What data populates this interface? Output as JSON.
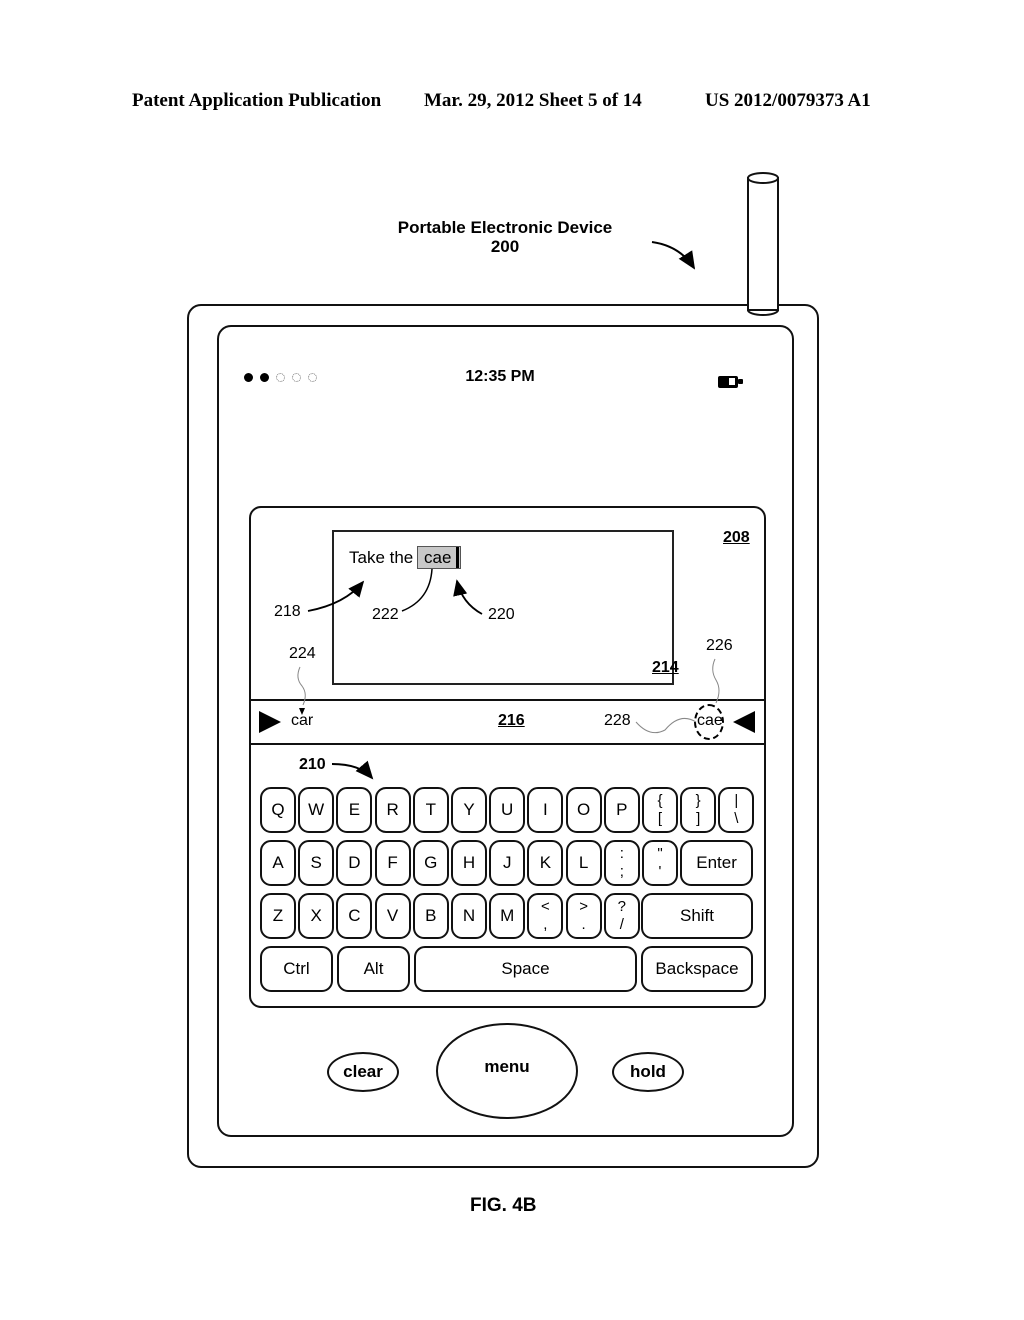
{
  "header": {
    "publication": "Patent Application Publication",
    "date_sheet": "Mar. 29, 2012  Sheet 5 of 14",
    "patent_number": "US 2012/0079373 A1"
  },
  "device": {
    "title": "Portable Electronic Device",
    "ref": "200"
  },
  "status_bar": {
    "signal_bars_total": 5,
    "signal_bars_filled": 2,
    "time": "12:35 PM",
    "battery_icon": "battery-icon"
  },
  "labels": {
    "panel": "208",
    "keyboard": "210",
    "text_area": "214",
    "suggestion_bar": "216",
    "typed_text": "218",
    "cursor": "220",
    "highlight": "222",
    "left_suggestion": "224",
    "right_suggestion": "226",
    "right_suggestion_marker": "228"
  },
  "text_area": {
    "typed": "Take the",
    "current_word": "cae"
  },
  "suggestions": {
    "left": "car",
    "right": "cae"
  },
  "keyboard": {
    "row1": [
      "Q",
      "W",
      "E",
      "R",
      "T",
      "Y",
      "U",
      "I",
      "O",
      "P"
    ],
    "row1_sym": [
      [
        "{",
        "["
      ],
      [
        "}",
        "]"
      ],
      [
        "|",
        "\\"
      ]
    ],
    "row2": [
      "A",
      "S",
      "D",
      "F",
      "G",
      "H",
      "J",
      "K",
      "L"
    ],
    "row2_sym": [
      [
        ":",
        ";"
      ],
      [
        "\"",
        "'"
      ]
    ],
    "enter": "Enter",
    "row3": [
      "Z",
      "X",
      "C",
      "V",
      "B",
      "N",
      "M"
    ],
    "row3_sym": [
      [
        "<",
        ","
      ],
      [
        ">",
        "."
      ],
      [
        "?",
        "/"
      ]
    ],
    "shift": "Shift",
    "ctrl": "Ctrl",
    "alt": "Alt",
    "space": "Space",
    "backspace": "Backspace"
  },
  "hardware_buttons": {
    "clear": "clear",
    "menu": "menu",
    "hold": "hold"
  },
  "figure_label": "FIG. 4B"
}
